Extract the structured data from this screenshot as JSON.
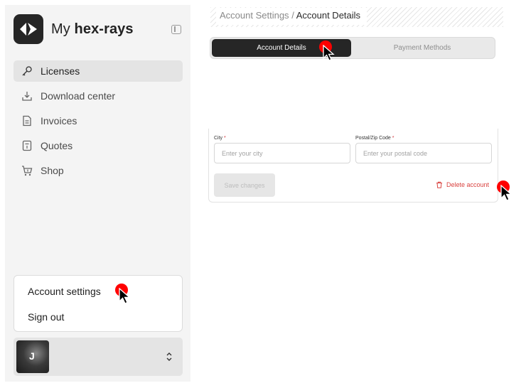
{
  "sidebar": {
    "brand_prefix": "My",
    "brand_name": "hex-rays",
    "nav": [
      {
        "label": "Licenses",
        "icon": "key-icon",
        "active": true
      },
      {
        "label": "Download center",
        "icon": "download-icon",
        "active": false
      },
      {
        "label": "Invoices",
        "icon": "document-icon",
        "active": false
      },
      {
        "label": "Quotes",
        "icon": "receipt-icon",
        "active": false
      },
      {
        "label": "Shop",
        "icon": "cart-icon",
        "active": false
      }
    ],
    "menu": {
      "account_settings": "Account settings",
      "sign_out": "Sign out"
    },
    "user": {
      "initial": "J"
    }
  },
  "breadcrumb": {
    "parent": "Account Settings",
    "separator": "/",
    "current": "Account Details"
  },
  "tabs": [
    {
      "label": "Account Details",
      "active": true
    },
    {
      "label": "Payment Methods",
      "active": false
    }
  ],
  "form": {
    "city": {
      "label": "City",
      "required_mark": "*",
      "placeholder": "Enter your city",
      "value": ""
    },
    "postal": {
      "label": "Postal/Zip Code",
      "required_mark": "*",
      "placeholder": "Enter your postal code",
      "value": ""
    },
    "save_label": "Save changes",
    "delete_label": "Delete account"
  },
  "colors": {
    "accent_dark": "#262626",
    "danger": "#d9423f",
    "cursor_marker": "#ff0000"
  }
}
